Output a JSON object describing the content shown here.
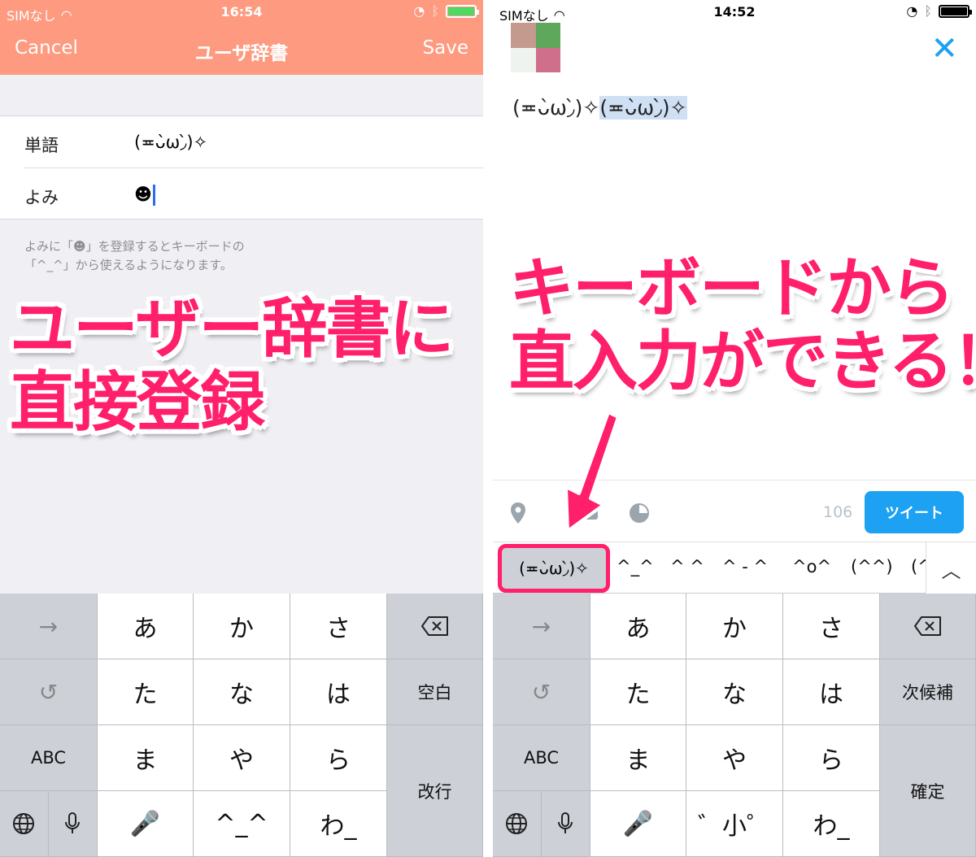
{
  "left": {
    "status": {
      "carrier": "SIMなし",
      "time": "16:54"
    },
    "nav": {
      "cancel": "Cancel",
      "title": "ユーザ辞書",
      "save": "Save"
    },
    "form": {
      "word_label": "単語",
      "word_value": "(≖ᴗ̀ω◞̀)✧",
      "reading_label": "よみ",
      "reading_value": "☻"
    },
    "hint": [
      "よみに「☻」を登録するとキーボードの",
      "「^_^」から使えるようになります。"
    ],
    "overlay": [
      "ユーザー辞書に",
      "直接登録"
    ],
    "keyboard": {
      "row1": [
        "→",
        "あ",
        "か",
        "さ",
        "⌫"
      ],
      "row2": [
        "↺",
        "た",
        "な",
        "は",
        "空白"
      ],
      "row3": [
        "ABC",
        "ま",
        "や",
        "ら",
        "改行"
      ],
      "row4": [
        "🌐",
        "🎤",
        "^_^",
        "わ_",
        "、。?!"
      ]
    }
  },
  "right": {
    "status": {
      "carrier": "SIMなし",
      "time": "14:52"
    },
    "close_icon": "✕",
    "tweet": {
      "text": "(≖ᴗ̀ω◞̀)✧",
      "selected": "(≖ᴗ̀ω◞̀)✧"
    },
    "overlay": [
      "キーボードから",
      "直入力ができる！"
    ],
    "toolbar": {
      "counter": "106",
      "tweet_button": "ツイート"
    },
    "candidates": {
      "selected": "(≖ᴗ̀ω◞̀)✧",
      "items": [
        "^_^",
        "^ ^",
        "^ - ^",
        "^o^",
        "(^^)",
        "(^"
      ],
      "chevron": "︿"
    },
    "keyboard": {
      "row1": [
        "→",
        "あ",
        "か",
        "さ",
        "⌫"
      ],
      "row2": [
        "↺",
        "た",
        "な",
        "は",
        "次候補"
      ],
      "row3": [
        "ABC",
        "ま",
        "や",
        "ら",
        "確定"
      ],
      "row4": [
        "🌐",
        "🎤",
        "゛小゜",
        "わ_",
        "、。?!"
      ]
    }
  },
  "colors": {
    "nav_bg": "#fd9a7f",
    "accent_pink": "#ff1f6a",
    "twitter_blue": "#1da1f2"
  }
}
